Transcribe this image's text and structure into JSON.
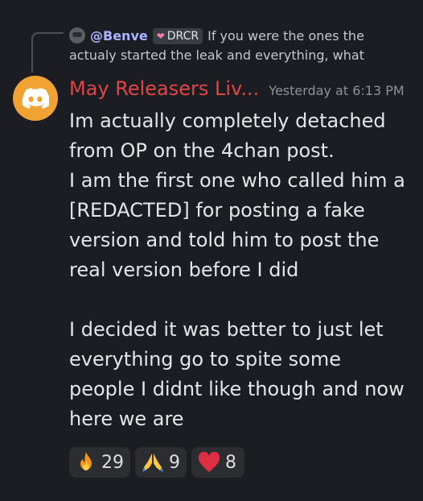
{
  "reply": {
    "username": "@Benve",
    "tag": "DRCR",
    "text_line1": "If you were the ones the",
    "text_line2": "actualy started the leak and everything, what"
  },
  "message": {
    "username": "May Releasers Liv...",
    "timestamp": "Yesterday at 6:13 PM",
    "content": "Im actually completely detached from OP on the 4chan post.\nI am the first one who called him a [REDACTED] for posting a fake version and told him to post the real version before I did\n\nI decided it was better to just let everything go to spite some people I didnt like though and now here we are"
  },
  "reactions": [
    {
      "icon": "fire-icon",
      "count": "29"
    },
    {
      "icon": "praying-hands-icon",
      "count": "9"
    },
    {
      "icon": "heart-icon",
      "count": "8"
    }
  ],
  "colors": {
    "background": "#1c1d22",
    "username": "#e24545",
    "reply_name": "#a9b3ff",
    "avatar": "#f0a232"
  }
}
